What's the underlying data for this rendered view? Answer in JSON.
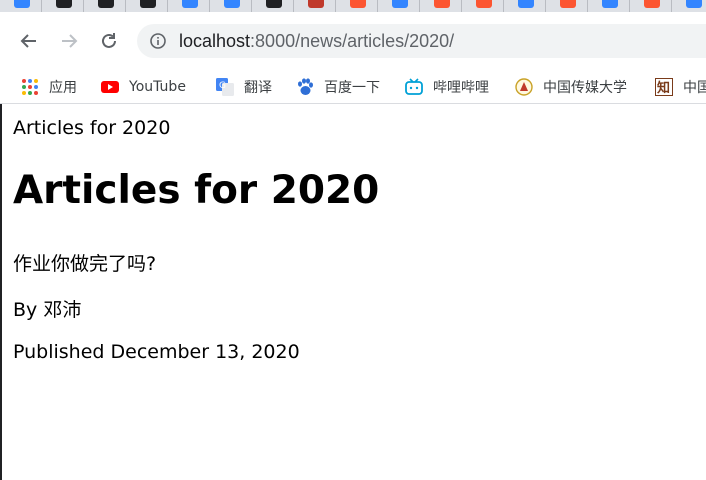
{
  "browser": {
    "tabs": [
      {
        "icon": "baidu-du-icon",
        "color": "#3385ff"
      },
      {
        "icon": "terminal-icon",
        "color": "#202124"
      },
      {
        "icon": "github-icon",
        "color": "#202124"
      },
      {
        "icon": "github-icon",
        "color": "#202124"
      },
      {
        "icon": "baidu-du-icon",
        "color": "#3385ff"
      },
      {
        "icon": "baidu-du-icon",
        "color": "#3385ff"
      },
      {
        "icon": "search-doc-icon",
        "color": "#202124"
      },
      {
        "icon": "book-icon",
        "color": "#c0392b"
      },
      {
        "icon": "csdn-c-icon",
        "color": "#fc5531"
      },
      {
        "icon": "baidu-du-icon",
        "color": "#3385ff"
      },
      {
        "icon": "csdn-c-icon",
        "color": "#fc5531"
      },
      {
        "icon": "csdn-c-icon",
        "color": "#fc5531"
      },
      {
        "icon": "baidu-du-icon",
        "color": "#3385ff"
      },
      {
        "icon": "csdn-c-icon",
        "color": "#fc5531"
      },
      {
        "icon": "baidu-du-icon",
        "color": "#3385ff"
      },
      {
        "icon": "csdn-c-icon",
        "color": "#fc5531"
      },
      {
        "icon": "baidu-du-icon",
        "color": "#3385ff"
      }
    ],
    "address": {
      "host": "localhost",
      "path": ":8000/news/articles/2020/"
    },
    "bookmarks": [
      {
        "label": "应用",
        "icon": "apps-grid-icon"
      },
      {
        "label": "YouTube",
        "icon": "youtube-icon"
      },
      {
        "label": "翻译",
        "icon": "google-translate-icon"
      },
      {
        "label": "百度一下",
        "icon": "baidu-paw-icon"
      },
      {
        "label": "哔哩哔哩",
        "icon": "bilibili-icon"
      },
      {
        "label": "中国传媒大学",
        "icon": "cuc-emblem-icon"
      },
      {
        "label": "中国",
        "icon": "zhihu-icon"
      }
    ]
  },
  "page": {
    "title": "Articles for 2020",
    "heading": "Articles for 2020",
    "article": {
      "headline": "作业你做完了吗?",
      "byline": "By 邓沛",
      "published": "Published December 13, 2020"
    }
  }
}
